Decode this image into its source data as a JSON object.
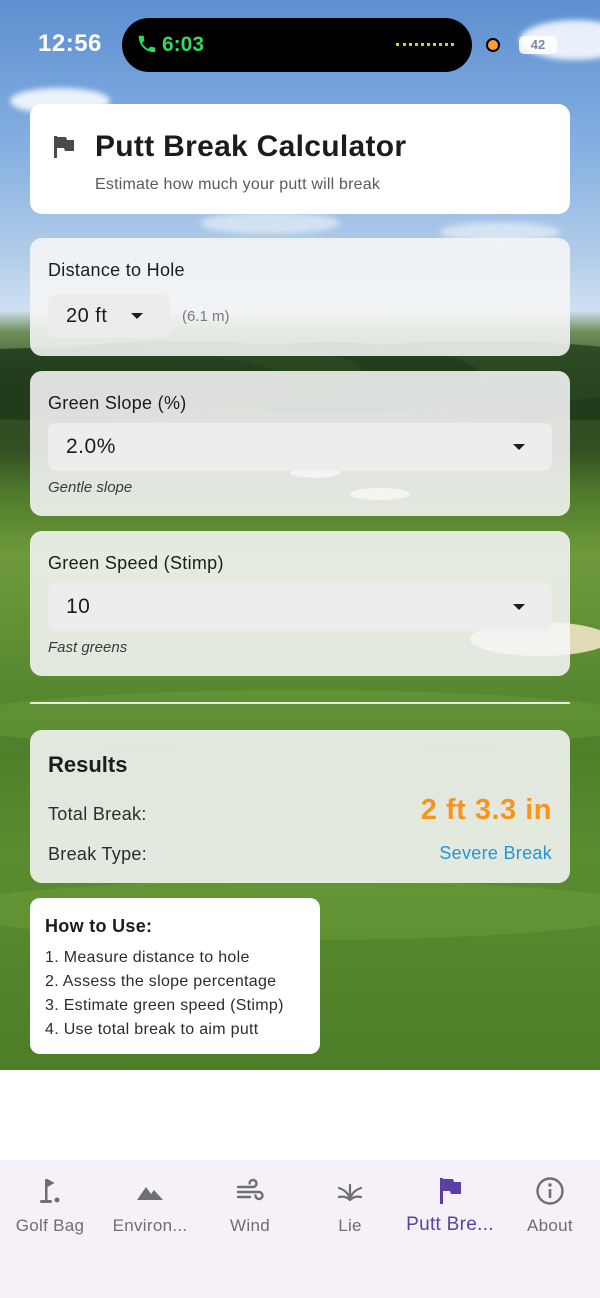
{
  "status_bar": {
    "time": "12:56",
    "call_time": "6:03",
    "battery": "42"
  },
  "header": {
    "title": "Putt Break Calculator",
    "subtitle": "Estimate how much your putt will break",
    "icon": "flag-icon"
  },
  "distance": {
    "label": "Distance to Hole",
    "value": "20 ft",
    "metric": "(6.1 m)"
  },
  "slope": {
    "label": "Green Slope (%)",
    "value": "2.0%",
    "hint": "Gentle slope"
  },
  "speed": {
    "label": "Green Speed (Stimp)",
    "value": "10",
    "hint": "Fast greens"
  },
  "results": {
    "title": "Results",
    "total_label": "Total Break:",
    "total_value": "2 ft 3.3 in",
    "type_label": "Break Type:",
    "type_value": "Severe Break",
    "colors": {
      "total": "#f7941d",
      "type": "#2196d9"
    }
  },
  "howto": {
    "title": "How to Use:",
    "steps": [
      "1. Measure distance to hole",
      "2. Assess the slope percentage",
      "3. Estimate green speed (Stimp)",
      "4. Use total break to aim putt"
    ]
  },
  "tabs": [
    {
      "label": "Golf Bag",
      "icon": "golf-flag-icon",
      "active": false
    },
    {
      "label": "Environ...",
      "icon": "mountain-icon",
      "active": false
    },
    {
      "label": "Wind",
      "icon": "wind-icon",
      "active": false
    },
    {
      "label": "Lie",
      "icon": "grass-icon",
      "active": false
    },
    {
      "label": "Putt Bre...",
      "icon": "flag-icon",
      "active": true
    },
    {
      "label": "About",
      "icon": "info-icon",
      "active": false
    }
  ],
  "accent_color": "#5b3fa8"
}
